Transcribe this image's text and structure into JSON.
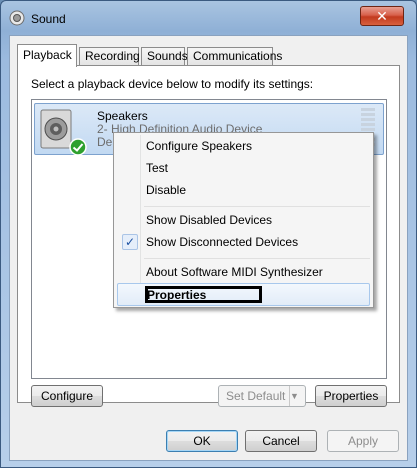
{
  "window": {
    "title": "Sound",
    "close_symbol": "✕"
  },
  "tabs": [
    {
      "label": "Playback"
    },
    {
      "label": "Recording"
    },
    {
      "label": "Sounds"
    },
    {
      "label": "Communications"
    }
  ],
  "panel": {
    "instruction": "Select a playback device below to modify its settings:"
  },
  "device": {
    "name": "Speakers",
    "line2": "2- High Definition Audio Device",
    "line3": "De"
  },
  "context_menu": {
    "items": [
      {
        "label": "Configure Speakers"
      },
      {
        "label": "Test"
      },
      {
        "label": "Disable"
      },
      {
        "label": "Show Disabled Devices"
      },
      {
        "label": "Show Disconnected Devices",
        "checked": true
      },
      {
        "label": "About Software MIDI Synthesizer"
      },
      {
        "label": "Properties"
      }
    ],
    "check_symbol": "✓"
  },
  "panel_buttons": {
    "configure": "Configure",
    "set_default": "Set Default",
    "split_arrow": "▼",
    "properties": "Properties"
  },
  "dialog_buttons": {
    "ok": "OK",
    "cancel": "Cancel",
    "apply": "Apply"
  },
  "colors": {
    "status_check": "#2ea02e",
    "selection_blue": "#c2d9f2",
    "close_red": "#c23a1f"
  }
}
